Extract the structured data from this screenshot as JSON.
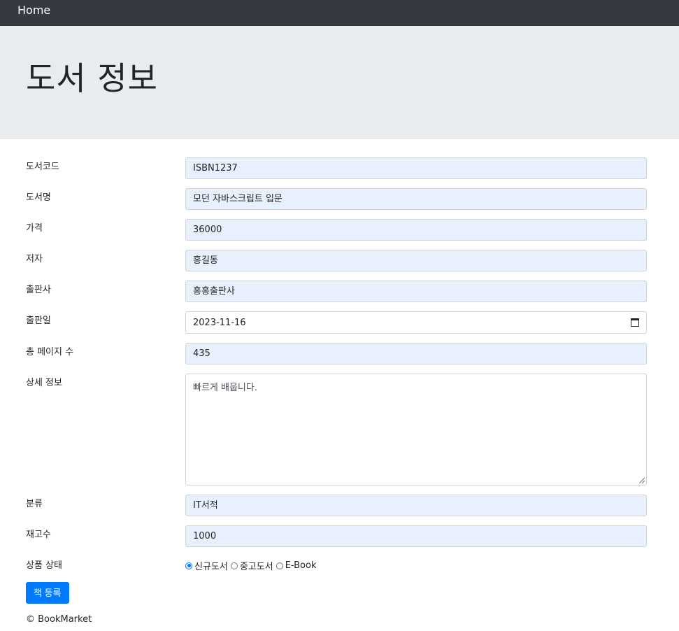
{
  "nav": {
    "home": "Home"
  },
  "jumbotron": {
    "title": "도서 정보"
  },
  "form": {
    "fields": [
      {
        "label": "도서코드",
        "value": "ISBN1237"
      },
      {
        "label": "도서명",
        "value": "모던 자바스크립트 입문"
      },
      {
        "label": "가격",
        "value": "36000"
      },
      {
        "label": "저자",
        "value": "홍길동"
      },
      {
        "label": "출판사",
        "value": "홍홍출판사"
      },
      {
        "label": "출판일",
        "value": "2023-11-16"
      },
      {
        "label": "총 페이지 수",
        "value": "435"
      },
      {
        "label": "상세 정보",
        "value": "빠르게 배웁니다."
      },
      {
        "label": "분류",
        "value": "IT서적"
      },
      {
        "label": "재고수",
        "value": "1000"
      },
      {
        "label": "상품 상태",
        "value": ""
      }
    ],
    "condition_options": [
      "신규도서",
      "중고도서",
      "E-Book"
    ],
    "condition_selected": "신규도서",
    "submit": "책 등록"
  },
  "footer": {
    "copyright": "© BookMarket"
  },
  "colors": {
    "navbar": "#343a40",
    "jumbotron": "#e9ecef",
    "input_fill": "#e8f0fe",
    "button": "#007bff"
  }
}
